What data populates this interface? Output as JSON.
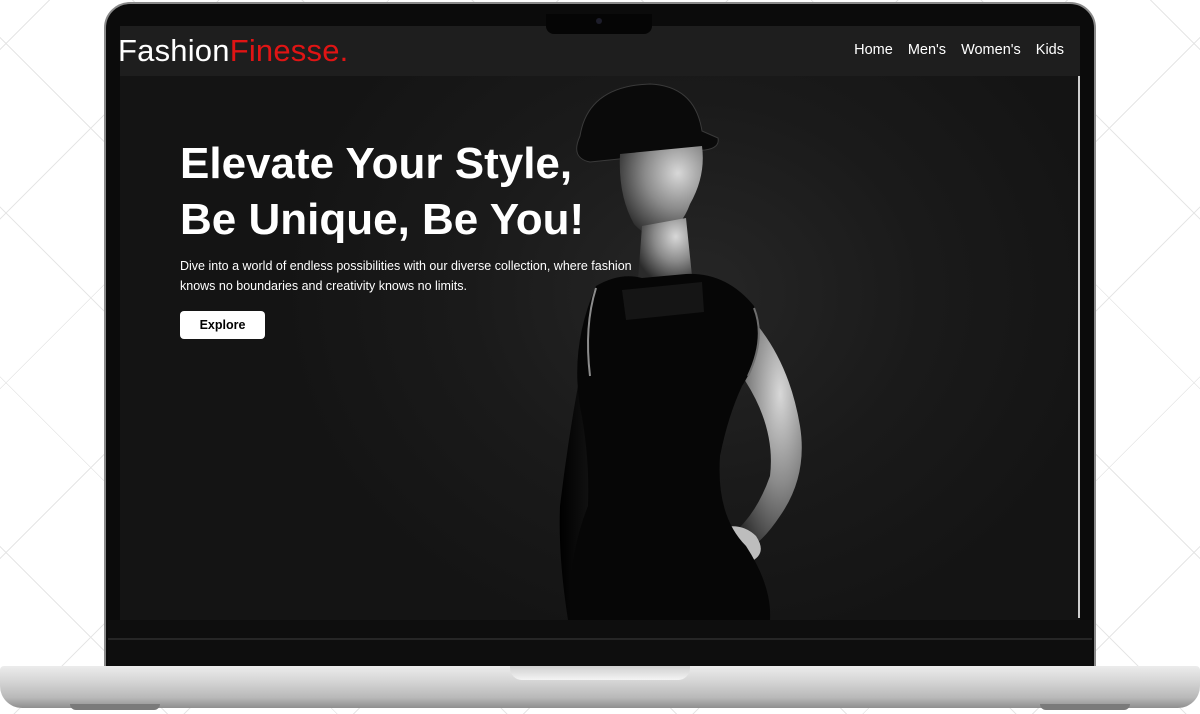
{
  "navbar": {
    "logo_main": "Fashion",
    "logo_accent": "Finesse.",
    "links": [
      {
        "label": "Home"
      },
      {
        "label": "Men's"
      },
      {
        "label": "Women's"
      },
      {
        "label": "Kids"
      }
    ]
  },
  "hero": {
    "title_line1": "Elevate Your Style,",
    "title_line2": "Be Unique, Be You!",
    "description_line1": "Dive into a world of endless possibilities with our diverse collection, where fashion",
    "description_line2": "knows no boundaries and creativity knows no limits.",
    "cta_label": "Explore",
    "image": "woman-in-black-dress-photo"
  },
  "colors": {
    "accent": "#e01414",
    "nav_background": "#1e1e1e",
    "hero_background": "#161616",
    "text": "#ffffff"
  }
}
